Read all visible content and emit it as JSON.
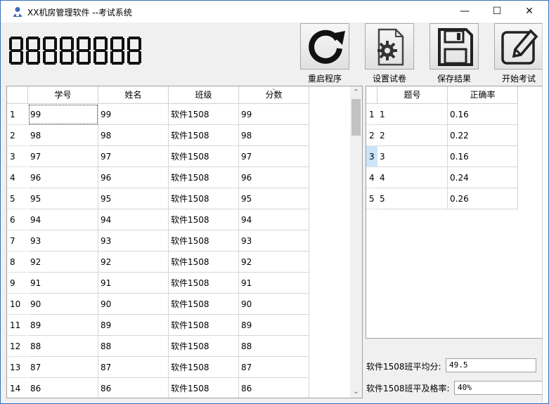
{
  "window": {
    "title": "XX机房管理软件 --考试系统",
    "minimize": "—",
    "maximize": "☐",
    "close": "✕"
  },
  "counter": {
    "display": "88888888",
    "color": "#111111"
  },
  "toolbar": [
    {
      "label": "重启程序",
      "icon": "refresh-icon"
    },
    {
      "label": "设置试卷",
      "icon": "gear-document-icon"
    },
    {
      "label": "保存结果",
      "icon": "floppy-disk-icon"
    },
    {
      "label": "开始考试",
      "icon": "pencil-icon"
    }
  ],
  "student_table": {
    "columns": [
      "学号",
      "姓名",
      "班级",
      "分数"
    ],
    "rows": [
      {
        "n": "1",
        "id": "99",
        "name": "99",
        "cls": "软件1508",
        "score": "99"
      },
      {
        "n": "2",
        "id": "98",
        "name": "98",
        "cls": "软件1508",
        "score": "98"
      },
      {
        "n": "3",
        "id": "97",
        "name": "97",
        "cls": "软件1508",
        "score": "97"
      },
      {
        "n": "4",
        "id": "96",
        "name": "96",
        "cls": "软件1508",
        "score": "96"
      },
      {
        "n": "5",
        "id": "95",
        "name": "95",
        "cls": "软件1508",
        "score": "95"
      },
      {
        "n": "6",
        "id": "94",
        "name": "94",
        "cls": "软件1508",
        "score": "94"
      },
      {
        "n": "7",
        "id": "93",
        "name": "93",
        "cls": "软件1508",
        "score": "93"
      },
      {
        "n": "8",
        "id": "92",
        "name": "92",
        "cls": "软件1508",
        "score": "92"
      },
      {
        "n": "9",
        "id": "91",
        "name": "91",
        "cls": "软件1508",
        "score": "91"
      },
      {
        "n": "10",
        "id": "90",
        "name": "90",
        "cls": "软件1508",
        "score": "90"
      },
      {
        "n": "11",
        "id": "89",
        "name": "89",
        "cls": "软件1508",
        "score": "89"
      },
      {
        "n": "12",
        "id": "88",
        "name": "88",
        "cls": "软件1508",
        "score": "88"
      },
      {
        "n": "13",
        "id": "87",
        "name": "87",
        "cls": "软件1508",
        "score": "87"
      },
      {
        "n": "14",
        "id": "86",
        "name": "86",
        "cls": "软件1508",
        "score": "86"
      }
    ]
  },
  "question_table": {
    "columns": [
      "题号",
      "正确率"
    ],
    "rows": [
      {
        "n": "1",
        "q": "1",
        "rate": "0.16"
      },
      {
        "n": "2",
        "q": "2",
        "rate": "0.22"
      },
      {
        "n": "3",
        "q": "3",
        "rate": "0.16"
      },
      {
        "n": "4",
        "q": "4",
        "rate": "0.24"
      },
      {
        "n": "5",
        "q": "5",
        "rate": "0.26"
      }
    ]
  },
  "stats": {
    "avg_label": "软件1508班平均分:",
    "avg_value": "49.5",
    "pass_label": "软件1508班平及格率:",
    "pass_value": "40%"
  }
}
